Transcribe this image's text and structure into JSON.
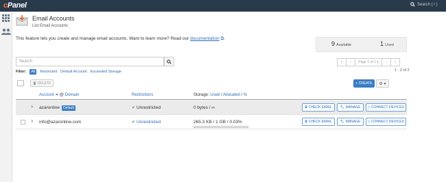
{
  "topbar": {
    "logo_prefix": "c",
    "logo_rest": "Panel",
    "search_placeholder": "Search ( / )"
  },
  "sidebar": {
    "items": [
      {
        "icon": "grid-icon"
      },
      {
        "icon": "users-icon"
      }
    ]
  },
  "header": {
    "title": "Email Accounts",
    "subtitle": "List Email Accounts"
  },
  "intro": {
    "text": "This feature lets you create and manage email accounts. Want to learn more? Read our ",
    "link": "documentation",
    "suffix": "."
  },
  "stats": {
    "available_value": "9",
    "available_label": "Available",
    "used_value": "1",
    "used_label": "Used"
  },
  "search": {
    "placeholder": "Search"
  },
  "filter": {
    "label": "Filter:",
    "options": [
      "All",
      "Restricted",
      "Default Account",
      "Exceeded Storage"
    ]
  },
  "pager": {
    "first": "«",
    "prev": "‹",
    "page_label": "Page 1 of 1 ▾",
    "next": "›",
    "last": "»",
    "count": "1 - 2 of 2"
  },
  "toolbar": {
    "delete_label": "DELETE",
    "create_label": "+ CREATE",
    "gear_label": "⚙ ▾"
  },
  "table": {
    "col_account": "Account",
    "col_sep": "@",
    "col_domain": "Domain",
    "col_restrictions": "Restrictions",
    "col_storage": "Storage:",
    "col_used": "Used",
    "col_allocated": "Allocated",
    "col_percent": "%",
    "rows": [
      {
        "account": "azaronline",
        "badge": "Default",
        "restriction": "Unrestricted",
        "storage": "0 bytes / ∞",
        "usage_fraction": 0
      },
      {
        "account": "info@azaronline.com",
        "badge": "",
        "restriction": "Unrestricted",
        "storage": "265.3 KB / 1 GB / 0.03%",
        "usage_fraction": 0.0003
      }
    ],
    "actions": {
      "check_email": "CHECK EMAIL",
      "manage": "MANAGE",
      "connect": "CONNECT DEVICES"
    }
  },
  "colors": {
    "topbar": "#293a4a",
    "accent": "#3b7dc4",
    "logo_accent": "#ff6c2c",
    "success": "#4a8a3a"
  }
}
